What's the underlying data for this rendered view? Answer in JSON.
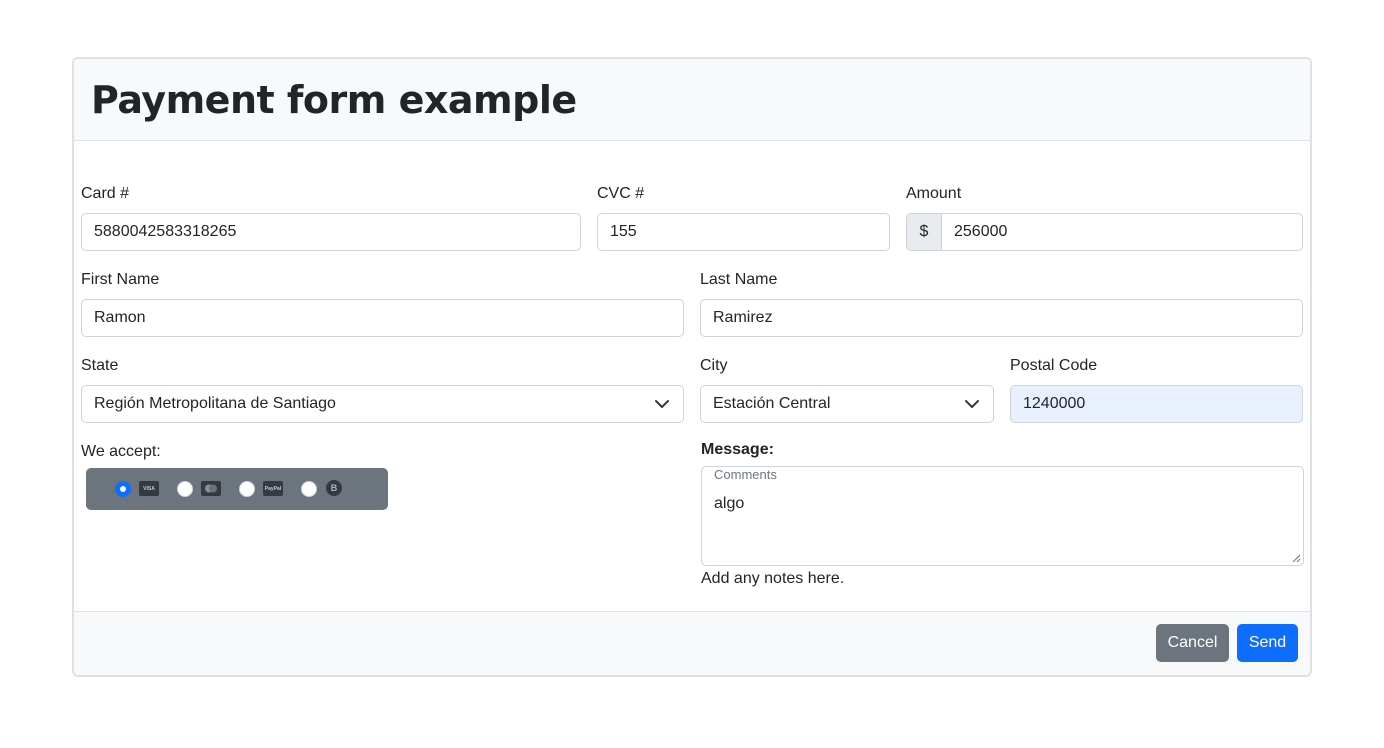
{
  "title": "Payment form example",
  "fields": {
    "card": {
      "label": "Card #",
      "value": "5880042583318265"
    },
    "cvc": {
      "label": "CVC #",
      "value": "155"
    },
    "amount": {
      "label": "Amount",
      "prefix": "$",
      "value": "256000"
    },
    "first_name": {
      "label": "First Name",
      "value": "Ramon"
    },
    "last_name": {
      "label": "Last Name",
      "value": "Ramirez"
    },
    "state": {
      "label": "State",
      "value": "Región Metropolitana de Santiago"
    },
    "city": {
      "label": "City",
      "value": "Estación Central"
    },
    "postal": {
      "label": "Postal Code",
      "value": "1240000"
    }
  },
  "accept": {
    "label": "We accept:",
    "options": [
      {
        "icon": "visa-card-icon",
        "text": "VISA",
        "checked": true
      },
      {
        "icon": "mastercard-icon",
        "text": "",
        "checked": false
      },
      {
        "icon": "paypal-icon",
        "text": "PayPal",
        "checked": false
      },
      {
        "icon": "bitcoin-icon",
        "text": "B",
        "checked": false
      }
    ]
  },
  "message": {
    "label": "Message:",
    "floating_label": "Comments",
    "value": "algo",
    "help": "Add any notes here."
  },
  "buttons": {
    "cancel": "Cancel",
    "send": "Send"
  },
  "colors": {
    "primary": "#0d6efd",
    "secondary": "#6c757d",
    "autofill": "#e8f0fe"
  }
}
